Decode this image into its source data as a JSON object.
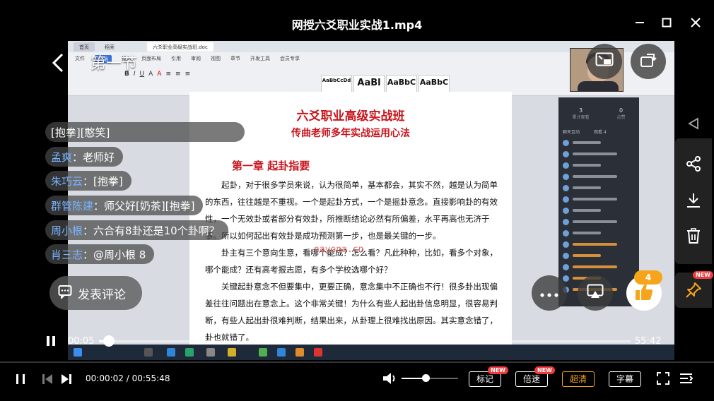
{
  "window": {
    "title": "网授六爻职业实战1.mp4"
  },
  "lesson": {
    "title": "第一节"
  },
  "chat": [
    {
      "name": "",
      "sep": "",
      "text": "[抱拳][憨笑]"
    },
    {
      "name": "孟爽",
      "sep": "：",
      "text": "老师好"
    },
    {
      "name": "朱巧云",
      "sep": "：",
      "text": "[抱拳]"
    },
    {
      "name": "群管陈建",
      "sep": "：",
      "text": "师父好[奶茶][抱拳]"
    },
    {
      "name": "周小根",
      "sep": "：",
      "text": "六合有8卦还是10个卦啊？"
    },
    {
      "name": "肖三志",
      "sep": "：",
      "text": "@周小根 8"
    }
  ],
  "comment_button": {
    "label": "发表评论"
  },
  "like": {
    "count": "4"
  },
  "badges": {
    "new": "NEW"
  },
  "video": {
    "current": "00:05",
    "duration": "55:42",
    "progress": 0.008,
    "watermark": "nayona.cn",
    "doc": {
      "title": "六爻职业高级实战班",
      "subtitle": "传曲老师多年实战运用心法",
      "chapter": "第一章    起卦指要",
      "paragraphs": [
        "起卦，对于很多学员来说，认为很简单，基本都会，其实不然，越是认为简单的东西，往往越是不重视。一个是起卦方式，一个是摇卦意念。直接影响卦的有效性，一个无效卦或者部分有效卦，所推断结论必然有所偏差，水平再高也无济于事。所以如何起出有效卦是成功预测第一步，也是最关键的一步。",
        "卦主有三个意向生意，看哪个能成？怎么看？凡此种种，比如，看多个对象，哪个能成？还有高考报志愿，有多个学校选哪个好？",
        "关键起卦意念不但要集中，更要正确，意念集中不正确也不行！很多卦出现偏差往往问题出在意念上。这个非常关键！为什么有些人起出卦信息明显，很容易判断，有些人起出卦很难判断，结果出来，从卦理上很难找出原因。其实意念错了，卦也就错了。"
      ],
      "ribbon_tabs": [
        "文件",
        "开始",
        "插入",
        "页面布局",
        "引用",
        "审阅",
        "视图",
        "章节",
        "开发工具",
        "会员专享"
      ],
      "doc_tab": "六爻职业高级实战班.doc",
      "styles": [
        "AaBbCcDd",
        "AaBl",
        "AaBbC",
        "AaBbC"
      ]
    },
    "live": {
      "stat1_value": "3",
      "stat1_label": "累计观看",
      "stat2_value": "0",
      "stat2_label": "点赞",
      "tab1": "聊天互动",
      "tab2": "观看 4"
    }
  },
  "player": {
    "time": "00:00:02 / 00:55:48",
    "volume": 0.4,
    "buttons": {
      "mark": "标记",
      "speed": "倍速",
      "quality": "超清",
      "subtitle": "字幕"
    }
  }
}
